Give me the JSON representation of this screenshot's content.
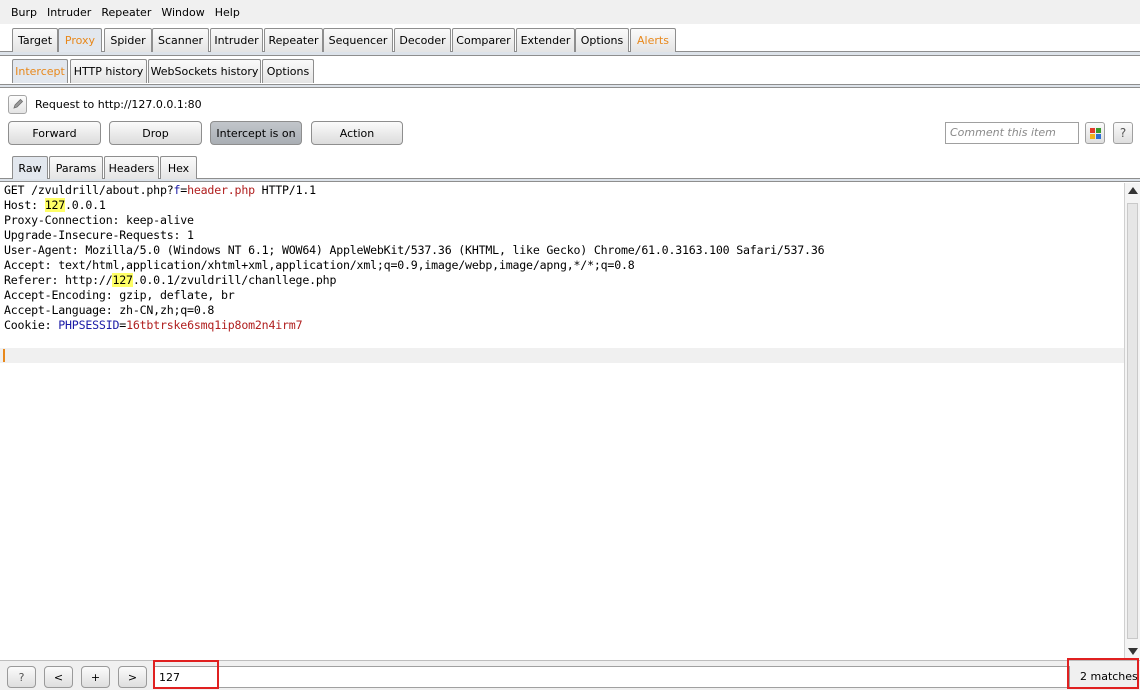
{
  "menu": [
    "Burp",
    "Intruder",
    "Repeater",
    "Window",
    "Help"
  ],
  "main_tabs": [
    "Target",
    "Proxy",
    "Spider",
    "Scanner",
    "Intruder",
    "Repeater",
    "Sequencer",
    "Decoder",
    "Comparer",
    "Extender",
    "Options",
    "Alerts"
  ],
  "sub_tabs": [
    "Intercept",
    "HTTP history",
    "WebSockets history",
    "Options"
  ],
  "request_label": "Request to http://127.0.0.1:80",
  "buttons": {
    "forward": "Forward",
    "drop": "Drop",
    "intercept": "Intercept is on",
    "action": "Action"
  },
  "comment_placeholder": "Comment this item",
  "help_label": "?",
  "editor_tabs": [
    "Raw",
    "Params",
    "Headers",
    "Hex"
  ],
  "request": {
    "line1": {
      "a": "GET /zvuldrill/about.php?",
      "param": "f",
      "eq": "=",
      "value": "header.php",
      "b": " HTTP/1.1"
    },
    "host": {
      "a": "Host: ",
      "hl": "127",
      "b": ".0.0.1"
    },
    "line3": "Proxy-Connection: keep-alive",
    "line4": "Upgrade-Insecure-Requests: 1",
    "line5": "User-Agent: Mozilla/5.0 (Windows NT 6.1; WOW64) AppleWebKit/537.36 (KHTML, like Gecko) Chrome/61.0.3163.100 Safari/537.36",
    "line6": "Accept: text/html,application/xhtml+xml,application/xml;q=0.9,image/webp,image/apng,*/*;q=0.8",
    "referer": {
      "a": "Referer: http://",
      "hl": "127",
      "b": ".0.0.1/zvuldrill/chanllege.php"
    },
    "line8": "Accept-Encoding: gzip, deflate, br",
    "line9": "Accept-Language: zh-CN,zh;q=0.8",
    "cookie": {
      "a": "Cookie: ",
      "name": "PHPSESSID",
      "eq": "=",
      "value": "16tbtrske6smq1ip8om2n4irm7"
    }
  },
  "bottom": {
    "help": "?",
    "prev": "<",
    "add": "+",
    "next": ">",
    "search_value": "127",
    "matches": "2 matches"
  },
  "colors": {
    "accent_orange": "#e8881b",
    "highlight": "#ffff66",
    "param_value": "#b01e1e",
    "cookie_name": "#1a1aa6",
    "annotation_red": "#e02020"
  }
}
